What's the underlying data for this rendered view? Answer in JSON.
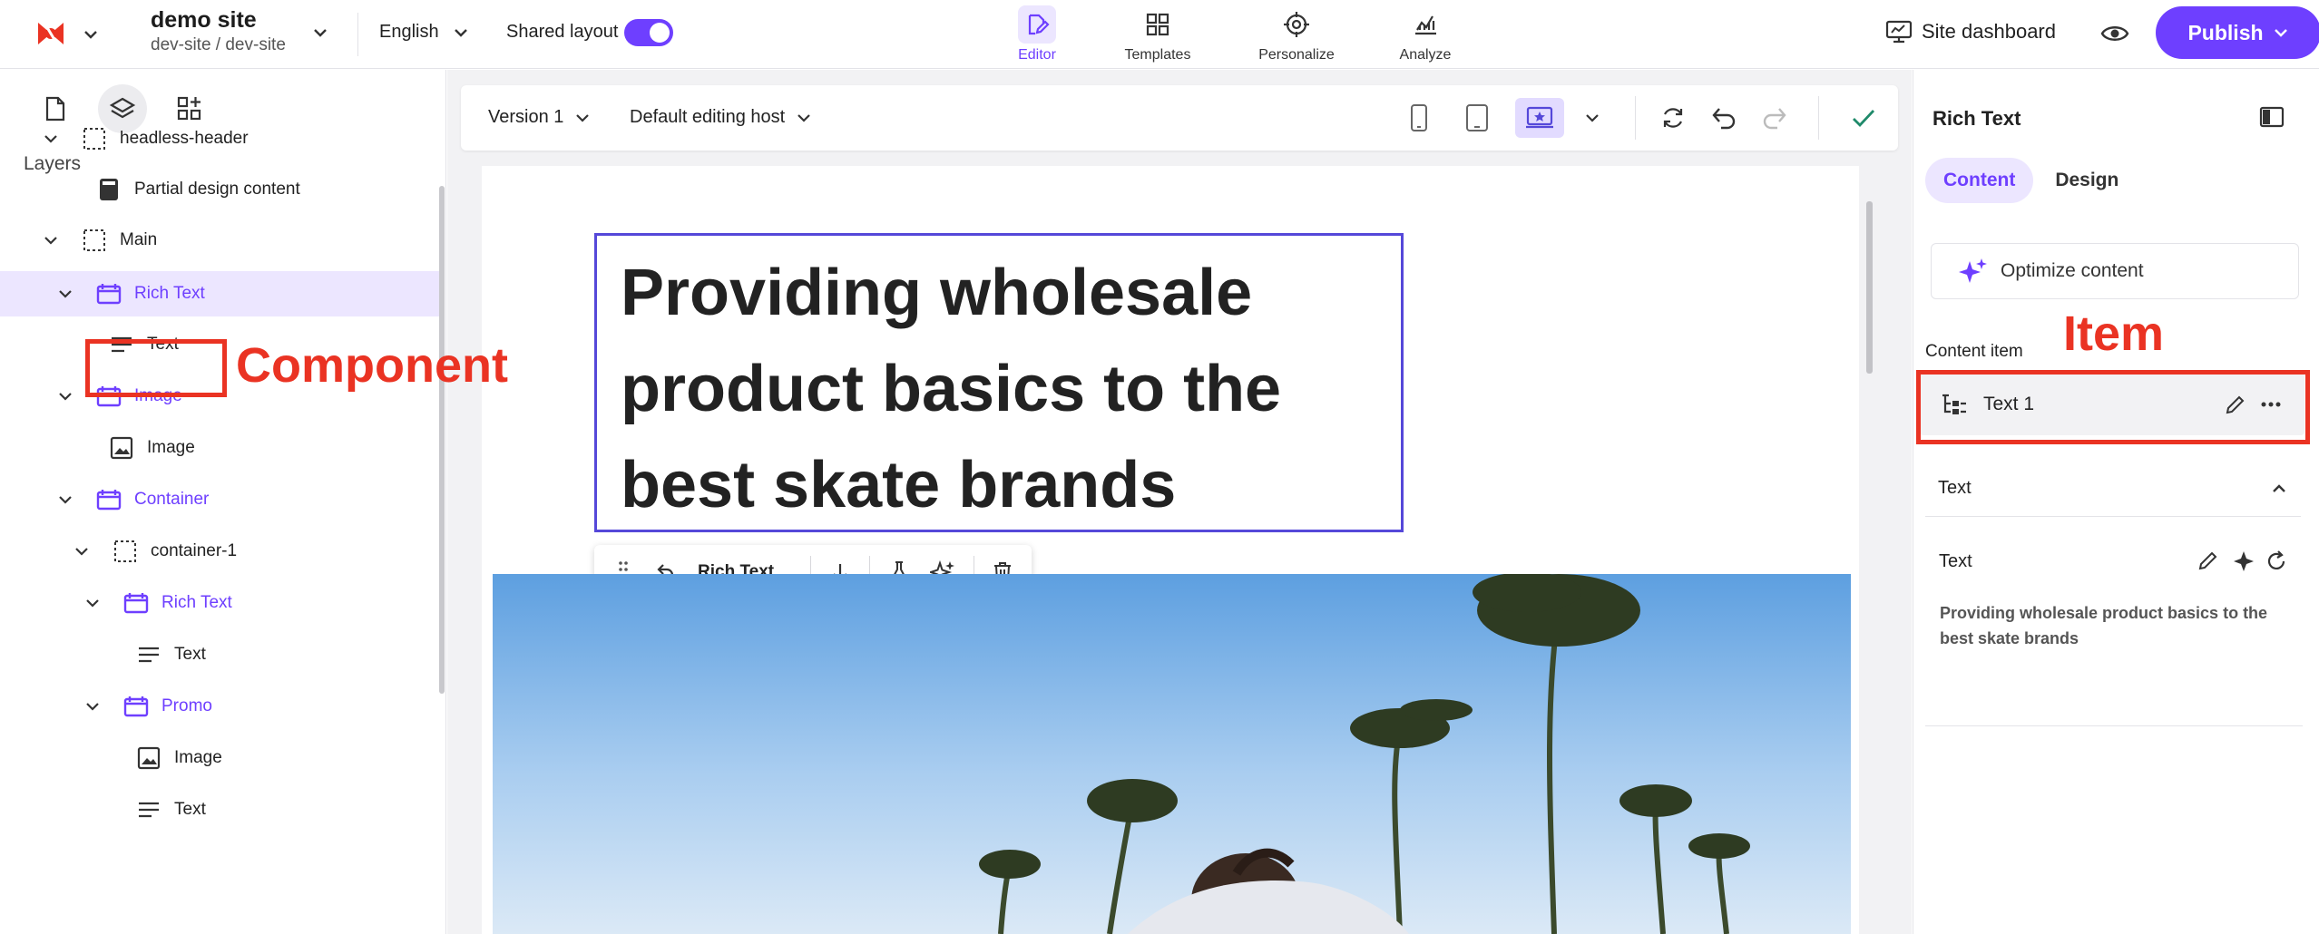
{
  "header": {
    "site_name": "demo site",
    "site_path": "dev-site / dev-site",
    "language": "English",
    "shared_layout_label": "Shared layout",
    "shared_layout_on": true,
    "tools": [
      {
        "label": "Editor",
        "icon": "edit-page-icon",
        "active": true
      },
      {
        "label": "Templates",
        "icon": "templates-grid-icon",
        "active": false
      },
      {
        "label": "Personalize",
        "icon": "crosshair-icon",
        "active": false
      },
      {
        "label": "Analyze",
        "icon": "analyze-chart-icon",
        "active": false
      }
    ],
    "dashboard_label": "Site dashboard",
    "publish_label": "Publish",
    "accent_color": "#6e3fff"
  },
  "left": {
    "layers_title": "Layers",
    "tree": [
      {
        "label": "headless-header",
        "icon": "placeholder-icon",
        "type": "placeholder"
      },
      {
        "label": "Partial design content",
        "icon": "partial-design-icon",
        "type": "partial"
      },
      {
        "label": "Main",
        "icon": "placeholder-icon",
        "type": "placeholder"
      },
      {
        "label": "Rich Text",
        "icon": "component-icon",
        "type": "component",
        "selected": true
      },
      {
        "label": "Text",
        "icon": "text-lines-icon",
        "type": "field"
      },
      {
        "label": "Image",
        "icon": "component-icon",
        "type": "component"
      },
      {
        "label": "Image",
        "icon": "image-field-icon",
        "type": "field"
      },
      {
        "label": "Container",
        "icon": "component-icon",
        "type": "component"
      },
      {
        "label": "container-1",
        "icon": "placeholder-icon",
        "type": "placeholder"
      },
      {
        "label": "Rich Text",
        "icon": "component-icon",
        "type": "component"
      },
      {
        "label": "Text",
        "icon": "text-lines-icon",
        "type": "field"
      },
      {
        "label": "Promo",
        "icon": "component-icon",
        "type": "component"
      },
      {
        "label": "Image",
        "icon": "image-field-icon",
        "type": "field"
      },
      {
        "label": "Text",
        "icon": "text-lines-icon",
        "type": "field"
      }
    ]
  },
  "canvas": {
    "version": "Version 1",
    "editing_host": "Default editing host",
    "heading": "Providing wholesale product basics to the best skate brands",
    "floating_toolbar_label": "Rich Text"
  },
  "right": {
    "title": "Rich Text",
    "tabs": [
      {
        "label": "Content",
        "active": true
      },
      {
        "label": "Design",
        "active": false
      }
    ],
    "optimize_label": "Optimize content",
    "content_item_label": "Content item",
    "content_item_name": "Text 1",
    "section_title": "Text",
    "field_label": "Text",
    "field_value": "Providing wholesale product basics to the best skate brands"
  },
  "annotations": {
    "component": "Component",
    "item": "Item",
    "color": "#ea3323"
  }
}
